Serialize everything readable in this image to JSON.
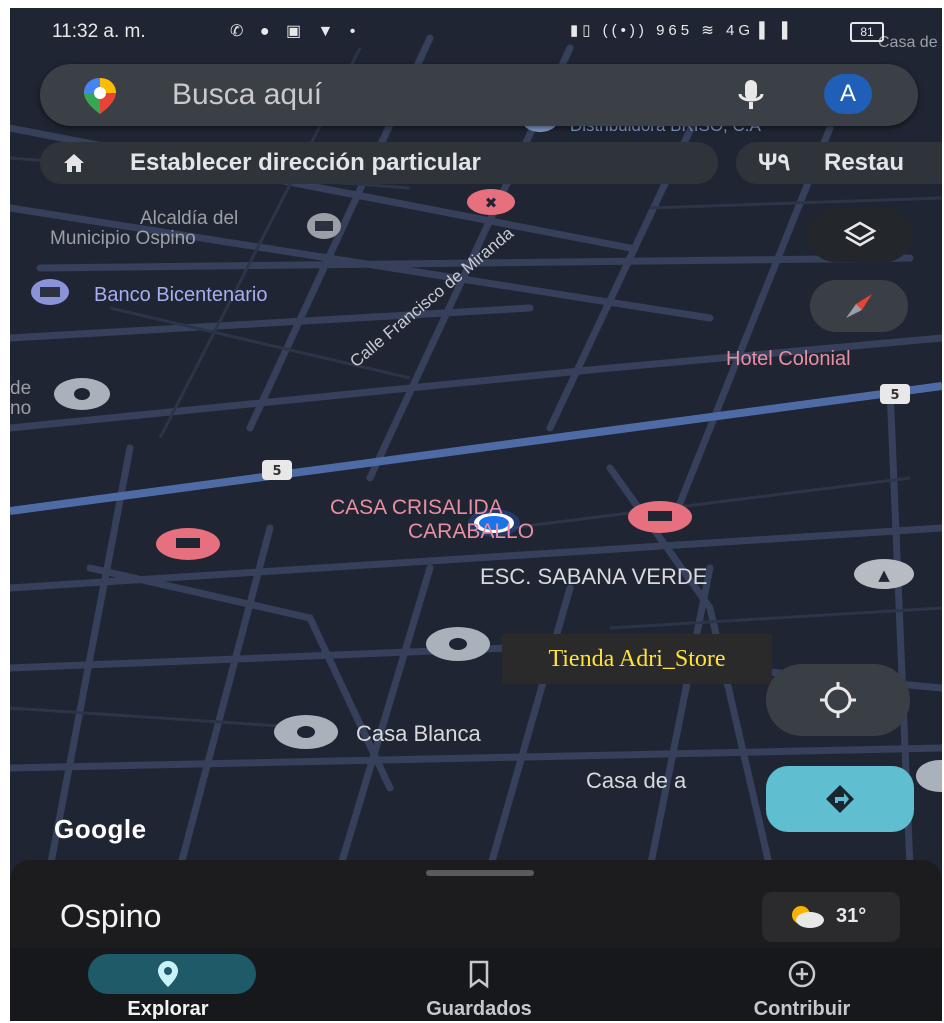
{
  "status_bar": {
    "time": "11:32 a. m.",
    "left_icons": "✆ ● ▣ ▼ •",
    "right_icons": "▮▯ ((•)) 965 ≋ 4G▐ ▐",
    "battery": "81"
  },
  "search": {
    "placeholder": "Busca aquí",
    "avatar_letter": "A",
    "logo_icon": "maps-pin-icon",
    "mic_icon": "microphone-icon"
  },
  "chips": [
    {
      "label": "Establecer dirección particular",
      "icon": "home-icon"
    },
    {
      "label": "Restau",
      "icon": "restaurant-icon"
    }
  ],
  "map": {
    "roads": [
      {
        "label": "Calle Francisco de Miranda"
      },
      {
        "shield": "5"
      },
      {
        "shield": "5"
      }
    ],
    "places": [
      {
        "label": "Alcaldía del",
        "type": "grey"
      },
      {
        "label": "Municipio Ospino",
        "type": "grey"
      },
      {
        "label": "Banco Bicentenario",
        "type": "grey"
      },
      {
        "label": "Hotel Colonial",
        "type": "pink"
      },
      {
        "label": "CASA CRISALIDA",
        "type": "pink"
      },
      {
        "label": "CARABALLO",
        "type": "pink"
      },
      {
        "label": "ESC. SABANA VERDE",
        "type": "white"
      },
      {
        "label": "Casa Blanca",
        "type": "white"
      },
      {
        "label": "Casa de a",
        "type": "white"
      },
      {
        "label": "Casa de",
        "type": "white"
      },
      {
        "label": "Distribuidora BRISO, C.A",
        "type": "grey"
      },
      {
        "label": "de",
        "type": "grey"
      },
      {
        "label": "no",
        "type": "grey"
      }
    ],
    "toast": "Tienda Adri_Store",
    "attribution": "Google"
  },
  "controls": {
    "layers_icon": "layers-icon",
    "compass_icon": "compass-icon",
    "locate_icon": "my-location-icon",
    "directions_icon": "directions-icon"
  },
  "sheet": {
    "place_name": "Ospino",
    "weather": {
      "temp": "31°",
      "icon": "partly-cloudy-icon"
    }
  },
  "bottom_nav": [
    {
      "label": "Explorar",
      "icon": "explore-pin-icon",
      "active": true
    },
    {
      "label": "Guardados",
      "icon": "bookmark-icon",
      "active": false
    },
    {
      "label": "Contribuir",
      "icon": "add-circle-icon",
      "active": false
    }
  ],
  "colors": {
    "map_bg": "#1f2532",
    "road": "#3e4a63",
    "highway": "#5b78b4",
    "accent": "#5fbfd0"
  }
}
